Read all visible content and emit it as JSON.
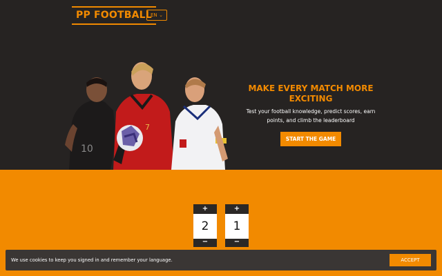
{
  "header": {
    "logo_text": "PP FOOTBALL",
    "language": "EN"
  },
  "hero": {
    "headline": "MAKE EVERY MATCH MORE EXCITING",
    "subtext": "Test your football knowledge, predict scores, earn points, and climb the leaderboard",
    "cta_label": "START THE GAME"
  },
  "score_predictor": {
    "home_score": "2",
    "away_score": "1",
    "plus_symbol": "+",
    "minus_symbol": "−"
  },
  "cookie_banner": {
    "message": "We use cookies to keep you signed in and remember your language.",
    "accept_label": "ACCEPT"
  },
  "colors": {
    "accent": "#f28a00",
    "dark": "#262322",
    "banner": "#3a3634"
  }
}
